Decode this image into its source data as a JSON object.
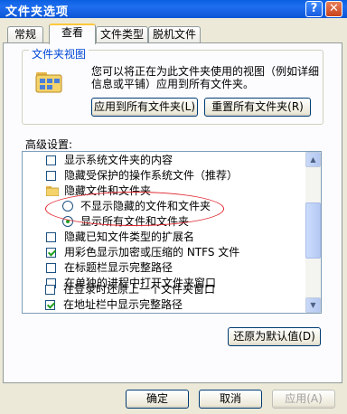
{
  "window": {
    "title": "文件夹选项",
    "help_glyph": "?",
    "close_glyph": "✕"
  },
  "tabs": [
    {
      "label": "常规"
    },
    {
      "label": "查看"
    },
    {
      "label": "文件类型"
    },
    {
      "label": "脱机文件"
    }
  ],
  "folder_views": {
    "title": "文件夹视图",
    "description": "您可以将正在为此文件夹使用的视图（例如详细信息或平铺）应用到所有文件夹。",
    "apply_button": "应用到所有文件夹(L)",
    "reset_button": "重置所有文件夹(R)"
  },
  "advanced": {
    "label": "高级设置:",
    "items": [
      {
        "type": "checkbox",
        "checked": false,
        "label": "显示系统文件夹的内容"
      },
      {
        "type": "checkbox",
        "checked": false,
        "label": "隐藏受保护的操作系统文件（推荐）"
      },
      {
        "type": "folder",
        "label": "隐藏文件和文件夹",
        "icon": "folder-icon"
      },
      {
        "type": "radio",
        "checked": false,
        "label": "不显示隐藏的文件和文件夹"
      },
      {
        "type": "radio",
        "checked": true,
        "label": "显示所有文件和文件夹"
      },
      {
        "type": "checkbox",
        "checked": false,
        "label": "隐藏已知文件类型的扩展名"
      },
      {
        "type": "checkbox",
        "checked": true,
        "label": "用彩色显示加密或压缩的 NTFS 文件"
      },
      {
        "type": "checkbox",
        "checked": false,
        "label": "在标题栏显示完整路径"
      },
      {
        "type": "checkbox",
        "checked": false,
        "label": "在单独的进程中打开文件夹窗口"
      },
      {
        "type": "checkbox",
        "checked": false,
        "label": "在登录时还原上一个文件夹窗口"
      },
      {
        "type": "checkbox",
        "checked": true,
        "label": "在地址栏中显示完整路径"
      }
    ],
    "restore_button": "还原为默认值(D)"
  },
  "scroll": {
    "up_glyph": "▲",
    "down_glyph": "▼"
  },
  "footer": {
    "ok": "确定",
    "cancel": "取消",
    "apply": "应用(A)"
  },
  "colors": {
    "title_bar": "#0a5fe0",
    "highlight_ring": "#e0242c",
    "active_tab_accent": "#ffc83c"
  }
}
